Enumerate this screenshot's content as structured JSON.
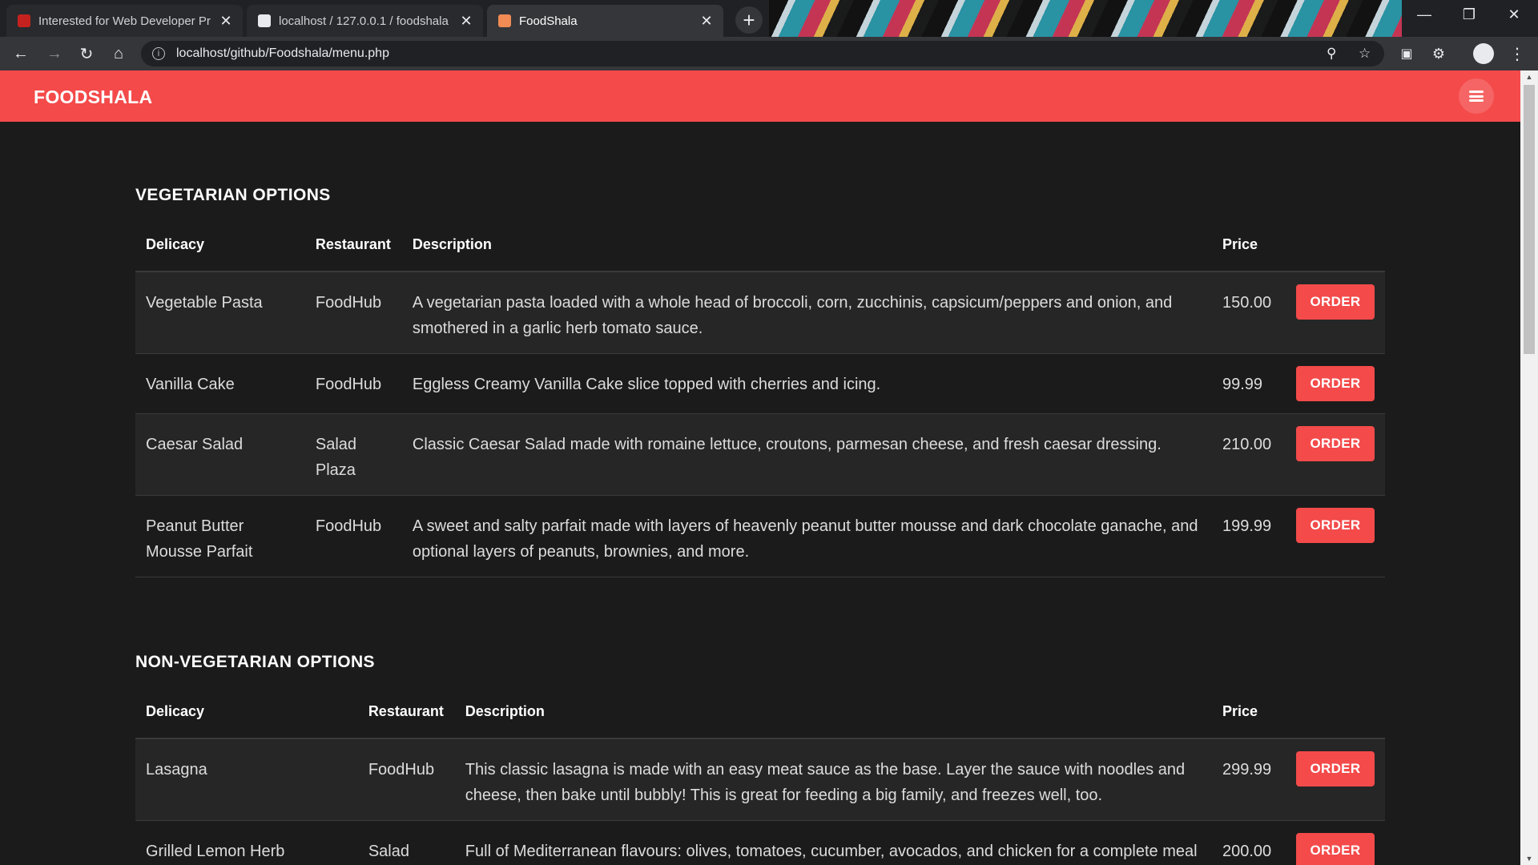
{
  "browser": {
    "tabs": [
      {
        "title": "Interested for Web Developer Pr",
        "favicon_color": "#c5221f",
        "active": false
      },
      {
        "title": "localhost / 127.0.0.1 / foodshala",
        "favicon_color": "#e8eaed",
        "active": false
      },
      {
        "title": "FoodShala",
        "favicon_color": "#f28b54",
        "active": true
      }
    ],
    "new_tab_icon": "+",
    "url": "localhost/github/Foodshala/menu.php"
  },
  "site": {
    "brand": "FOODSHALA",
    "accent_color": "#f44a4a"
  },
  "columns": {
    "delicacy": "Delicacy",
    "restaurant": "Restaurant",
    "description": "Description",
    "price": "Price"
  },
  "order_label": "ORDER",
  "vegetarian": {
    "title": "VEGETARIAN OPTIONS",
    "rows": [
      {
        "delicacy": "Vegetable Pasta",
        "restaurant": "FoodHub",
        "description": "A vegetarian pasta loaded with a whole head of broccoli, corn, zucchinis, capsicum/peppers and onion, and smothered in a garlic herb tomato sauce.",
        "price": "150.00"
      },
      {
        "delicacy": "Vanilla Cake",
        "restaurant": "FoodHub",
        "description": "Eggless Creamy Vanilla Cake slice topped with cherries and icing.",
        "price": "99.99"
      },
      {
        "delicacy": "Caesar Salad",
        "restaurant": "Salad Plaza",
        "description": "Classic Caesar Salad made with romaine lettuce, croutons, parmesan cheese, and fresh caesar dressing.",
        "price": "210.00"
      },
      {
        "delicacy": "Peanut Butter Mousse Parfait",
        "restaurant": "FoodHub",
        "description": "A sweet and salty parfait made with layers of heavenly peanut butter mousse and dark chocolate ganache, and optional layers of peanuts, brownies, and more.",
        "price": "199.99"
      }
    ]
  },
  "nonvegetarian": {
    "title": "NON-VEGETARIAN OPTIONS",
    "rows": [
      {
        "delicacy": "Lasagna",
        "restaurant": "FoodHub",
        "description": "This classic lasagna is made with an easy meat sauce as the base. Layer the sauce with noodles and cheese, then bake until bubbly! This is great for feeding a big family, and freezes well, too.",
        "price": "299.99"
      },
      {
        "delicacy": "Grilled Lemon Herb",
        "restaurant": "Salad",
        "description": "Full of Mediterranean flavours: olives, tomatoes, cucumber, avocados, and chicken for a complete meal",
        "price": "200.00"
      }
    ]
  }
}
